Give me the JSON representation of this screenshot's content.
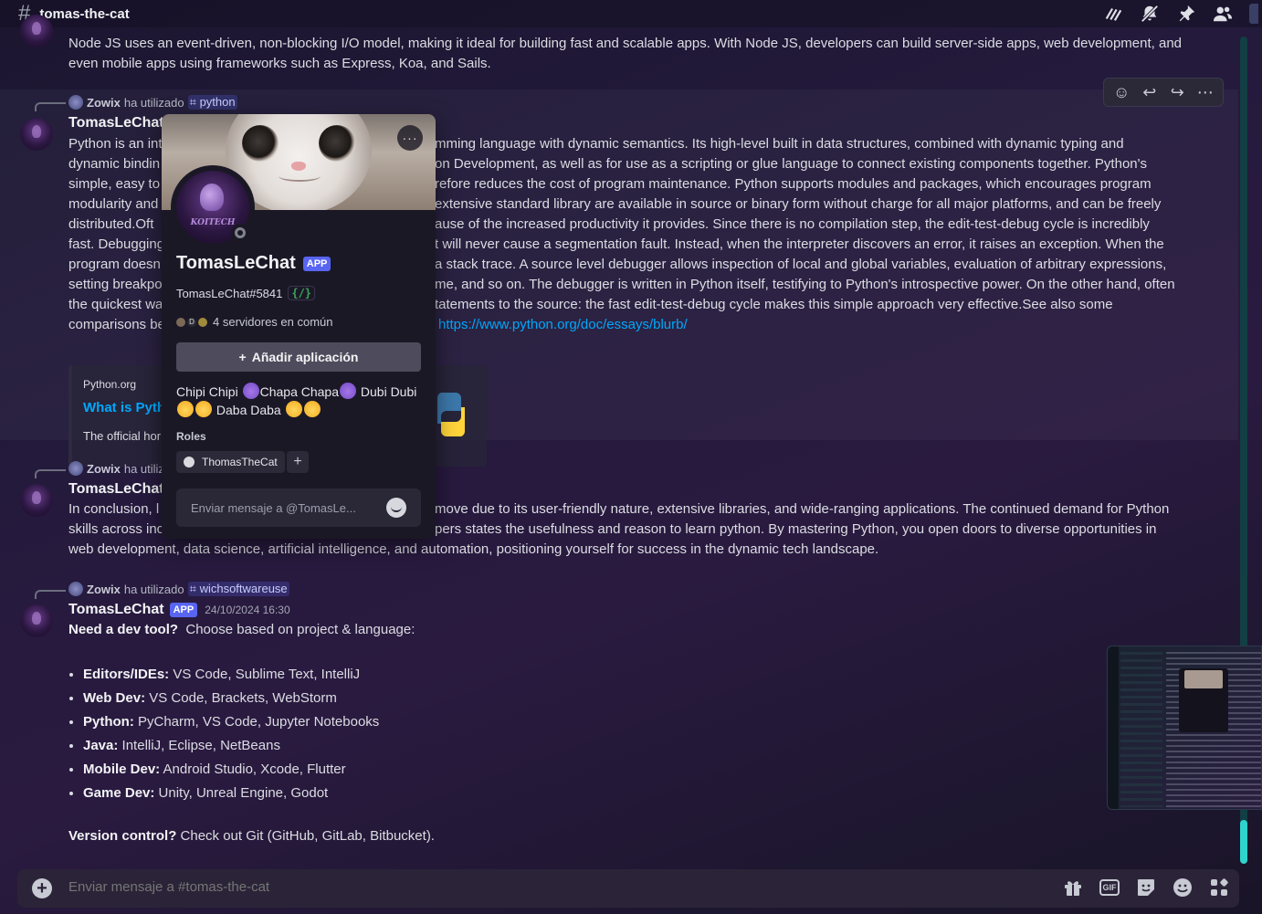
{
  "header": {
    "channel": "tomas-the-cat",
    "icons": [
      "threads-icon",
      "mute-bell-icon",
      "pin-icon",
      "members-icon"
    ]
  },
  "messages": {
    "m1": {
      "text": "Node JS uses an event-driven, non-blocking I/O model, making it ideal for building fast and scalable apps. With Node JS, developers can build server-side apps, web development, and even mobile apps using frameworks such as Express, Koa, and Sails."
    },
    "m2": {
      "reply_user": "Zowix",
      "reply_used": "ha utilizado",
      "reply_cmd": "python",
      "username": "TomasLeChat",
      "lines": [
        "Python is an int",
        "dynamic bindin",
        "simple, easy to",
        "modularity and",
        "distributed.Oft",
        "fast. Debugging",
        "program doesn",
        "setting breakpo",
        "the quickest wa",
        "comparisons be"
      ],
      "lines_right": [
        "mming language with dynamic semantics. Its high-level built in data structures, combined with dynamic typing and",
        "on Development, as well as for use as a scripting or glue language to connect existing components together. Python's",
        "refore reduces the cost of program maintenance. Python supports modules and packages, which encourages program",
        "extensive standard library are available in source or binary form without charge for all major platforms, and can be freely",
        "ause of the increased productivity it provides. Since there is no compilation step, the edit-test-debug cycle is incredibly",
        "t will never cause a segmentation fault. Instead, when the interpreter discovers an error, it raises an exception. When the",
        "a stack trace. A source level debugger allows inspection of local and global variables, evaluation of arbitrary expressions,",
        "me, and so on. The debugger is written in Python itself, testifying to Python's introspective power. On the other hand, often",
        "tatements to the source: the fast edit-test-debug cycle makes this simple approach very effective.See also some",
        "https://www.python.org/doc/essays/blurb/"
      ],
      "embed": {
        "provider": "Python.org",
        "title": "What is Pyth",
        "desc": "The official hor"
      }
    },
    "m3": {
      "reply_user": "Zowix",
      "reply_used": "ha utiliz",
      "username": "TomasLeChat",
      "line1_left": "In conclusion, l",
      "line1_right": "move due to its user-friendly nature, extensive libraries, and wide-ranging applications. The continued demand for Python",
      "line2_left": "skills across inc",
      "line2_right": "pers states the usefulness and reason to learn python. By mastering Python, you open doors to diverse opportunities in",
      "line3": "web development, data science, artificial intelligence, and automation, positioning yourself for success in the dynamic tech landscape."
    },
    "m4": {
      "reply_user": "Zowix",
      "reply_used": "ha utilizado",
      "reply_cmd": "wichsoftwareuse",
      "username": "TomasLeChat",
      "badge": "APP",
      "timestamp": "24/10/2024 16:30",
      "intro_bold": "Need a dev tool?",
      "intro_rest": "Choose based on project & language:",
      "tools": [
        {
          "label": "Editors/IDEs:",
          "value": "VS Code, Sublime Text, IntelliJ"
        },
        {
          "label": "Web Dev:",
          "value": "VS Code, Brackets, WebStorm"
        },
        {
          "label": "Python:",
          "value": "PyCharm, VS Code, Jupyter Notebooks"
        },
        {
          "label": "Java:",
          "value": "IntelliJ, Eclipse, NetBeans"
        },
        {
          "label": "Mobile Dev:",
          "value": "Android Studio, Xcode, Flutter"
        },
        {
          "label": "Game Dev:",
          "value": "Unity, Unreal Engine, Godot"
        }
      ],
      "outro_bold": "Version control?",
      "outro_rest": "Check out Git (GitHub, GitLab, Bitbucket)."
    }
  },
  "popout": {
    "name": "TomasLeChat",
    "badge": "APP",
    "tag": "TomasLeChat#5841",
    "dev_badge": "{/}",
    "servers_text": "4 servidores en común",
    "server_letter": "D",
    "add_app": "Añadir aplicación",
    "bio_parts": [
      "Chipi Chipi",
      "Chapa Chapa",
      "Dubi Dubi",
      "Daba Daba"
    ],
    "roles_heading": "Roles",
    "role": "ThomasTheCat",
    "message_placeholder": "Enviar mensaje a @TomasLe...",
    "more_label": "···",
    "logo_text": "KOITECH"
  },
  "composer": {
    "placeholder": "Enviar mensaje a #tomas-the-cat",
    "gif_label": "GIF"
  },
  "colors": {
    "accent": "#5865f2",
    "link": "#00a8fc",
    "scroll_thumb": "#2fd3cd"
  }
}
